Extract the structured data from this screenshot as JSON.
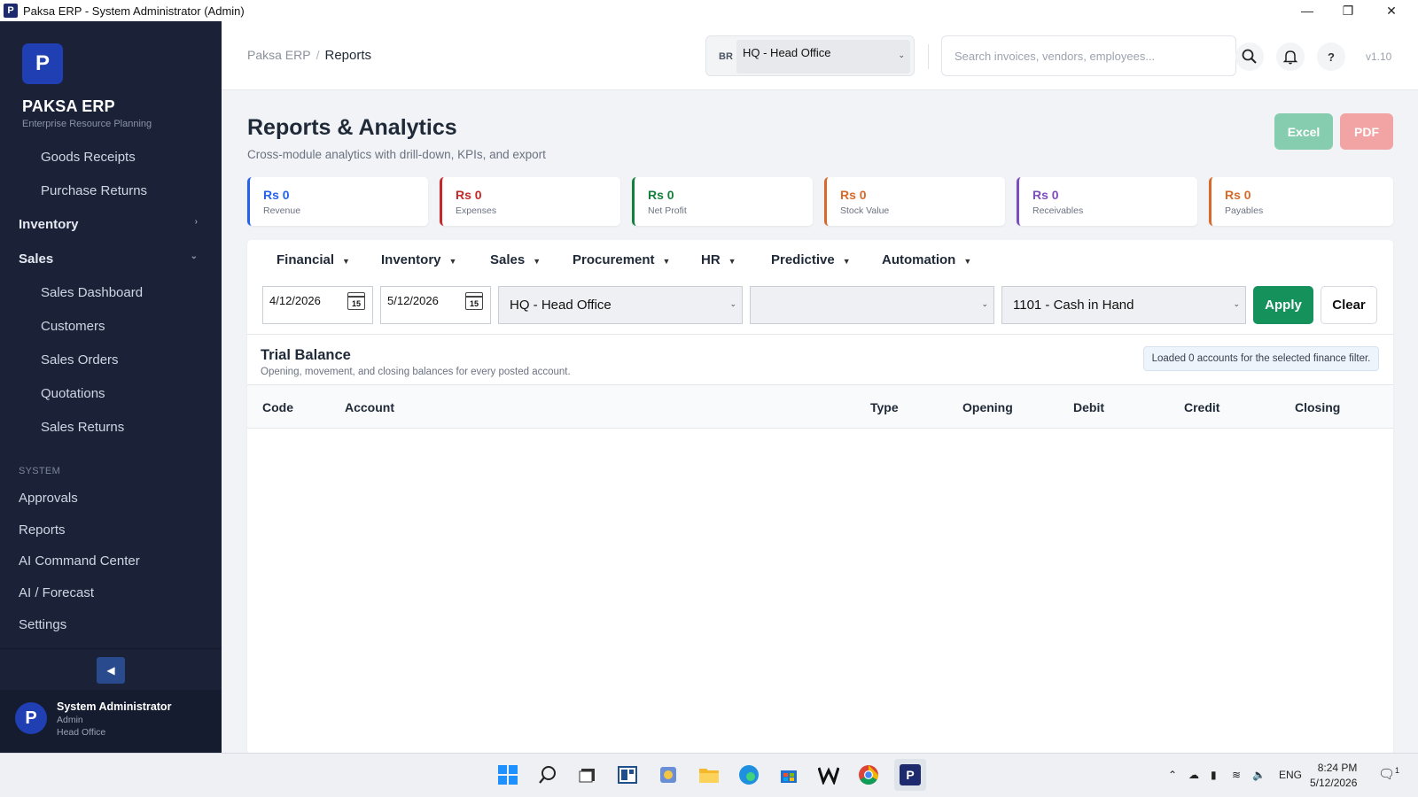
{
  "window": {
    "title": "Paksa ERP - System Administrator (Admin)",
    "app_icon": "P",
    "controls": [
      "minimize-icon",
      "restore-icon",
      "close-icon"
    ]
  },
  "sidebar": {
    "logo_letter": "P",
    "brand": "PAKSA ERP",
    "tagline": "Enterprise Resource Planning",
    "items": [
      {
        "label": "Goods Receipts"
      },
      {
        "label": "Purchase Returns"
      },
      {
        "label": "Inventory"
      },
      {
        "label": "Sales"
      },
      {
        "label": "Sales Dashboard"
      },
      {
        "label": "Customers"
      },
      {
        "label": "Sales Orders"
      },
      {
        "label": "Quotations"
      },
      {
        "label": "Sales Returns"
      }
    ],
    "section_system": "SYSTEM",
    "system_items": [
      {
        "label": "Approvals"
      },
      {
        "label": "Reports"
      },
      {
        "label": "AI Command Center"
      },
      {
        "label": "AI / Forecast"
      },
      {
        "label": "Settings"
      }
    ],
    "user": {
      "avatar": "P",
      "name": "System Administrator",
      "role": "Admin",
      "branch": "Head Office"
    }
  },
  "topbar": {
    "breadcrumb_root": "Paksa ERP",
    "breadcrumb_sep": "/",
    "breadcrumb_current": "Reports",
    "branch_code": "BR",
    "branch_value": "HQ - Head Office",
    "search_placeholder": "Search invoices, vendors, employees...",
    "help": "?",
    "version": "v1.10"
  },
  "page": {
    "title": "Reports & Analytics",
    "subtitle": "Cross-module analytics with drill-down, KPIs, and export",
    "excel_label": "Excel",
    "pdf_label": "PDF"
  },
  "kpis": [
    {
      "value": "Rs 0",
      "label": "Revenue",
      "color": "#2563eb"
    },
    {
      "value": "Rs 0",
      "label": "Expenses",
      "color": "#c62828"
    },
    {
      "value": "Rs 0",
      "label": "Net Profit",
      "color": "#15803d"
    },
    {
      "value": "Rs 0",
      "label": "Stock Value",
      "color": "#d9692a"
    },
    {
      "value": "Rs 0",
      "label": "Receivables",
      "color": "#7c4dbd"
    },
    {
      "value": "Rs 0",
      "label": "Payables",
      "color": "#d9692a"
    }
  ],
  "menus": [
    "Financial",
    "Inventory",
    "Sales",
    "Procurement",
    "HR",
    "Predictive",
    "Automation"
  ],
  "filters": {
    "date_from": "4/12/2026",
    "date_to": "5/12/2026",
    "calendar_day": "15",
    "branch": "HQ - Head Office",
    "second": "",
    "account": "1101 - Cash in Hand",
    "apply_label": "Apply",
    "clear_label": "Clear"
  },
  "report": {
    "title": "Trial Balance",
    "subtitle": "Opening, movement, and closing balances for every posted account.",
    "info": "Loaded 0 accounts for the selected finance filter.",
    "columns": [
      "Code",
      "Account",
      "Type",
      "Opening",
      "Debit",
      "Credit",
      "Closing"
    ],
    "rows": []
  },
  "taskbar": {
    "language": "ENG",
    "time": "8:24 PM",
    "date": "5/12/2026",
    "notifications": "1"
  }
}
